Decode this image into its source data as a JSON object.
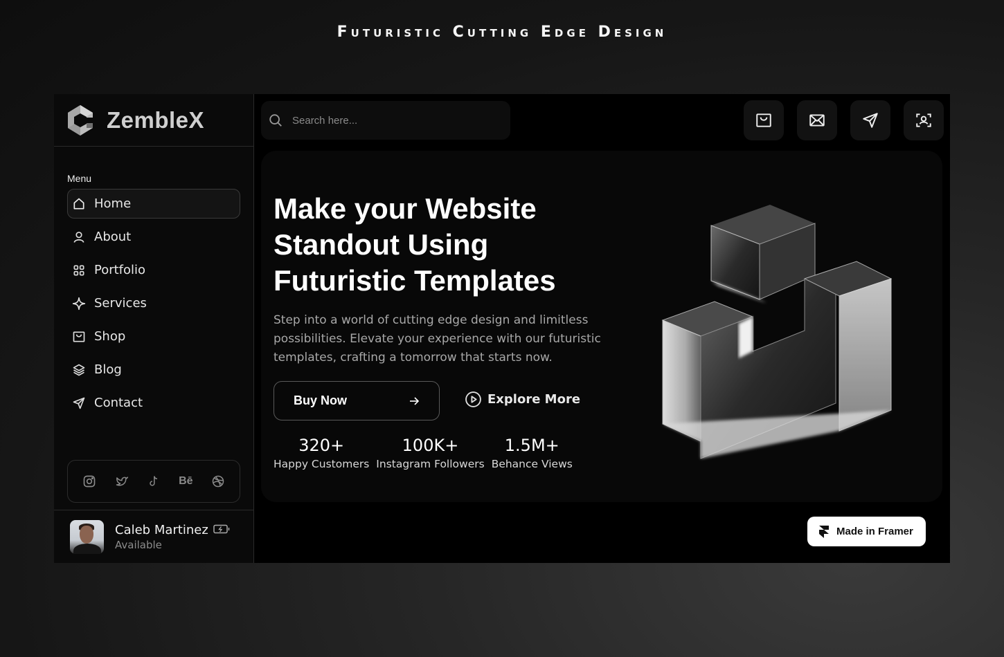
{
  "page": {
    "heading": "Futuristic Cutting Edge Design"
  },
  "brand": {
    "name": "ZembleX",
    "logo_icon": "hexagon-c-logo"
  },
  "sidebar": {
    "menu_label": "Menu",
    "items": [
      {
        "label": "Home",
        "icon": "home-icon",
        "active": true
      },
      {
        "label": "About",
        "icon": "user-icon",
        "active": false
      },
      {
        "label": "Portfolio",
        "icon": "grid-icon",
        "active": false
      },
      {
        "label": "Services",
        "icon": "sparkle-icon",
        "active": false
      },
      {
        "label": "Shop",
        "icon": "shopping-bag-icon",
        "active": false
      },
      {
        "label": "Blog",
        "icon": "layers-icon",
        "active": false
      },
      {
        "label": "Contact",
        "icon": "send-icon",
        "active": false
      }
    ],
    "socials": [
      {
        "name": "instagram",
        "icon": "instagram-icon"
      },
      {
        "name": "twitter",
        "icon": "twitter-icon"
      },
      {
        "name": "tiktok",
        "icon": "tiktok-icon"
      },
      {
        "name": "behance",
        "icon": "behance-icon",
        "text": "Bē"
      },
      {
        "name": "dribbble",
        "icon": "dribbble-icon"
      }
    ],
    "profile": {
      "name": "Caleb Martinez",
      "status": "Available",
      "status_icon": "battery-charging-icon"
    }
  },
  "topbar": {
    "search_placeholder": "Search here...",
    "search_value": "",
    "actions": [
      {
        "name": "shop",
        "icon": "shopping-bag-icon"
      },
      {
        "name": "mail",
        "icon": "mail-icon"
      },
      {
        "name": "send",
        "icon": "send-icon"
      },
      {
        "name": "profile-scan",
        "icon": "user-scan-icon"
      }
    ]
  },
  "hero": {
    "title": "Make your Website\nStandout Using\nFuturistic  Templates",
    "subtitle": "Step into a world of cutting edge design and limitless possibilities. Elevate your experience with our futuristic templates, crafting a tomorrow that starts now.",
    "primary_cta": "Buy Now",
    "secondary_cta": "Explore More",
    "stats": [
      {
        "value": "320+",
        "label": "Happy Customers"
      },
      {
        "value": "100K+",
        "label": "Instagram Followers"
      },
      {
        "value": "1.5M+",
        "label": "Behance Views"
      }
    ]
  },
  "badge": {
    "label": "Made in Framer"
  },
  "colors": {
    "background": "#000000",
    "sidebar": "#0a0a0a",
    "accent": "#ffffff",
    "muted_text": "#a8a8a8"
  }
}
